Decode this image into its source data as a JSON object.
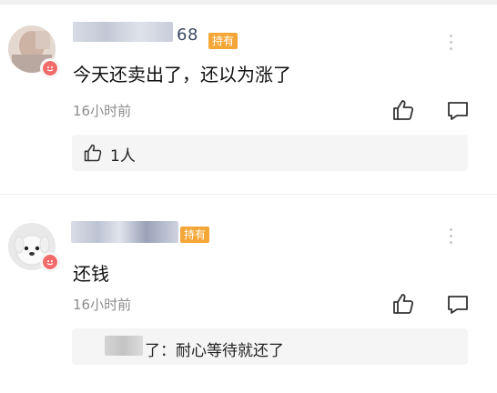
{
  "comments": [
    {
      "username_visible_suffix": "68",
      "holder_tag": "持有",
      "content": "今天还卖出了，还以为涨了",
      "time": "16小时前",
      "likes_label": "1人",
      "avatar_icon": "blurred-user-avatar",
      "badge_icon": "smile-icon"
    },
    {
      "holder_tag": "持有",
      "content": "还钱",
      "time": "16小时前",
      "reply_text": "了：耐心等待就还了",
      "avatar_icon": "plush-puppy-avatar",
      "badge_icon": "smile-icon"
    }
  ],
  "colors": {
    "hold_tag": "#f4a636",
    "username": "#3d4a63",
    "timestamp": "#8c8c8c",
    "badge": "#f26b6b"
  }
}
